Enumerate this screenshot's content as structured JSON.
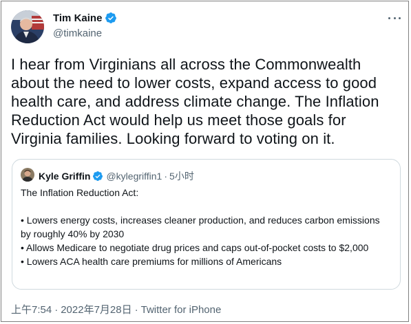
{
  "author": {
    "name": "Tim Kaine",
    "handle": "@timkaine",
    "verified_icon": "verified-badge-icon"
  },
  "tweet": {
    "text": "I hear from Virginians all across the Commonwealth about the need to lower costs, expand access to good health care, and address climate change. The Inflation Reduction Act would help us meet those goals for Virginia families. Looking forward to voting on it."
  },
  "quoted": {
    "name": "Kyle Griffin",
    "handle": "@kylegriffin1",
    "dot": "·",
    "time": "5小时",
    "lines": [
      "The Inflation Reduction Act:",
      "",
      "• Lowers energy costs, increases cleaner production, and reduces carbon emissions by roughly 40% by 2030",
      "• Allows Medicare to negotiate drug prices and caps out-of-pocket costs to $2,000",
      "• Lowers ACA health care premiums for millions of Americans"
    ]
  },
  "meta": {
    "time": "上午7:54",
    "dot": "·",
    "date": "2022年7月28日",
    "source": "Twitter for iPhone"
  },
  "colors": {
    "verified": "#1d9bf0",
    "text": "#0f1419",
    "secondary": "#536471",
    "border": "#cfd9de"
  }
}
